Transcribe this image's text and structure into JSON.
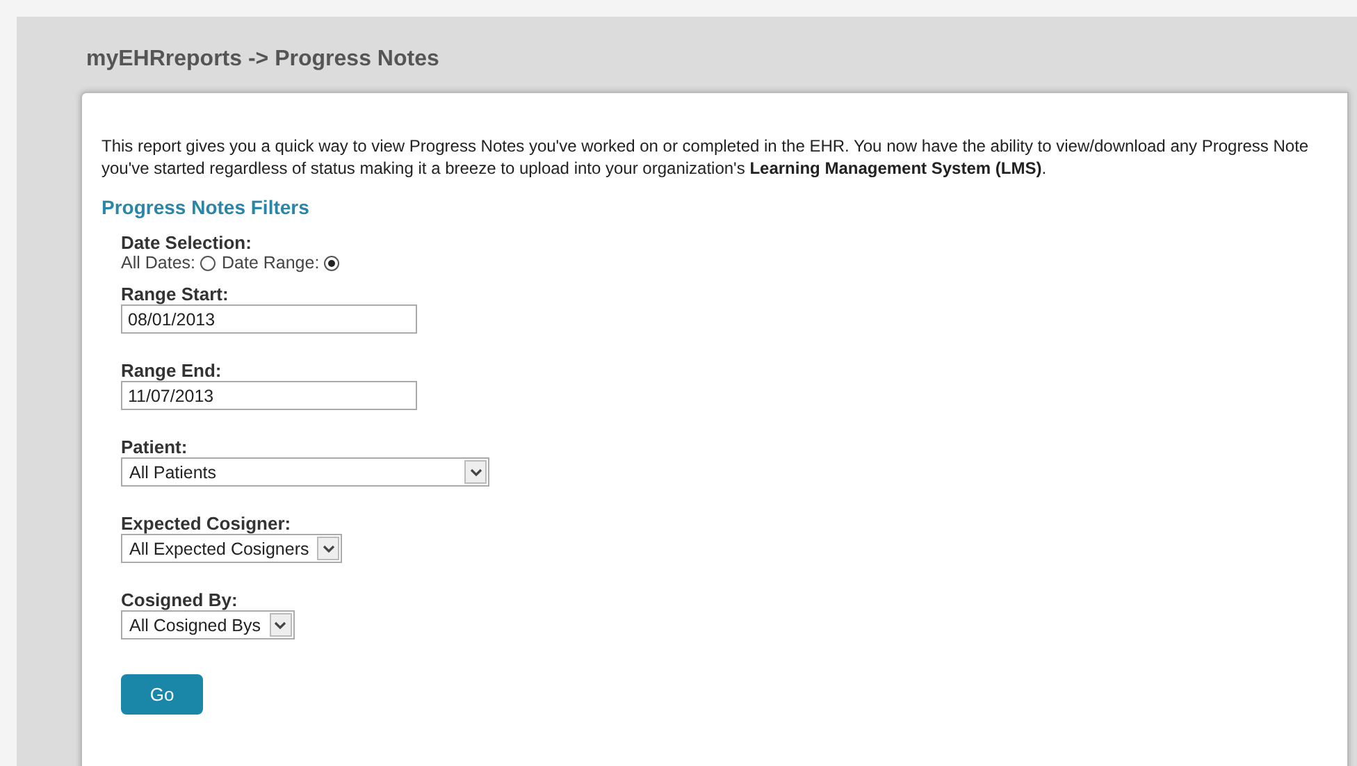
{
  "header": {
    "title": "myEHRreports -> Progress Notes"
  },
  "intro": "This report gives you a quick way to view Progress Notes you've worked on or completed in the EHR. You now have the ability to view/download any Progress Note you've started regardless of status making it a breeze to upload into your organization's **Learning Management System (LMS)**.",
  "filters_title": "Progress Notes Filters",
  "date_selection": {
    "label": "Date Selection:",
    "options": [
      {
        "label": "All Dates:",
        "selected": false
      },
      {
        "label": "Date Range:",
        "selected": true
      }
    ]
  },
  "fields": [
    {
      "kind": "text",
      "label": "Range Start:",
      "value": "08/01/2013"
    },
    {
      "kind": "text",
      "label": "Range End:",
      "value": "11/07/2013"
    },
    {
      "kind": "select",
      "label": "Patient:",
      "value": "All Patients",
      "wide": true
    },
    {
      "kind": "select",
      "label": "Expected Cosigner:",
      "value": "All Expected Cosigners",
      "wide": false
    },
    {
      "kind": "select",
      "label": "Cosigned By:",
      "value": "All Cosigned Bys",
      "wide": false
    }
  ],
  "button": "Go"
}
